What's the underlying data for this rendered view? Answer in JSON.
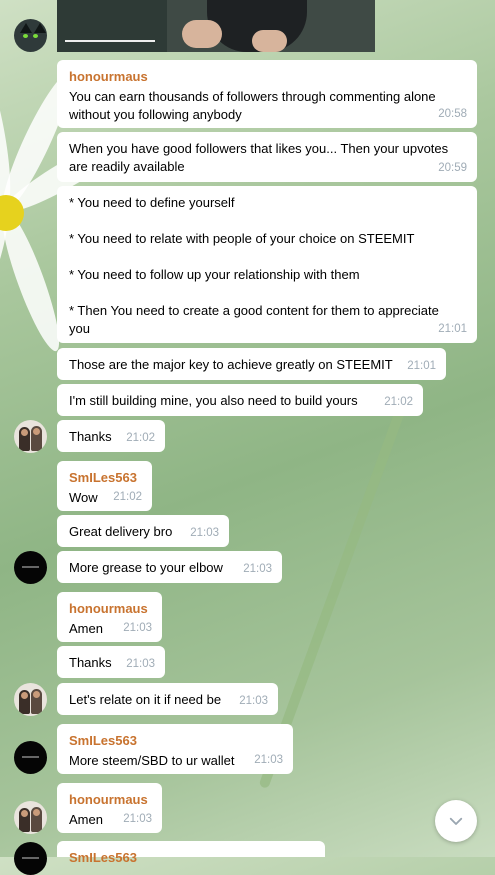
{
  "messages": [
    {
      "sender": "honourmaus",
      "text": "You can earn thousands of followers through commenting alone\nwithout you following anybody",
      "time": "20:58"
    },
    {
      "sender": "",
      "text": "When you have good followers that likes you... Then your upvotes\nare readily available",
      "time": "20:59"
    },
    {
      "sender": "",
      "text": "* You need to define yourself\n\n* You need to relate with people of your choice on STEEMIT\n\n* You need to follow up your relationship with them\n\n* Then You need to create a good content for them to appreciate\nyou",
      "time": "21:01"
    },
    {
      "sender": "",
      "text": "Those are the major key to achieve greatly on STEEMIT",
      "time": "21:01"
    },
    {
      "sender": "",
      "text": "I'm still building mine, you also need to build yours",
      "time": "21:02"
    },
    {
      "sender": "",
      "text": "Thanks",
      "time": "21:02"
    },
    {
      "sender": "SmILes563",
      "text": "Wow",
      "time": "21:02"
    },
    {
      "sender": "",
      "text": "Great delivery bro",
      "time": "21:03"
    },
    {
      "sender": "",
      "text": "More grease to your elbow",
      "time": "21:03"
    },
    {
      "sender": "honourmaus",
      "text": "Amen",
      "time": "21:03"
    },
    {
      "sender": "",
      "text": "Thanks",
      "time": "21:03"
    },
    {
      "sender": "",
      "text": "Let's relate on it if need be",
      "time": "21:03"
    },
    {
      "sender": "SmILes563",
      "text": "More steem/SBD to ur wallet",
      "time": "21:03"
    },
    {
      "sender": "honourmaus",
      "text": "Amen",
      "time": "21:03"
    },
    {
      "sender": "SmILes563",
      "text": "",
      "time": ""
    }
  ],
  "icons": {
    "scroll_down": "chevron-down-icon"
  }
}
